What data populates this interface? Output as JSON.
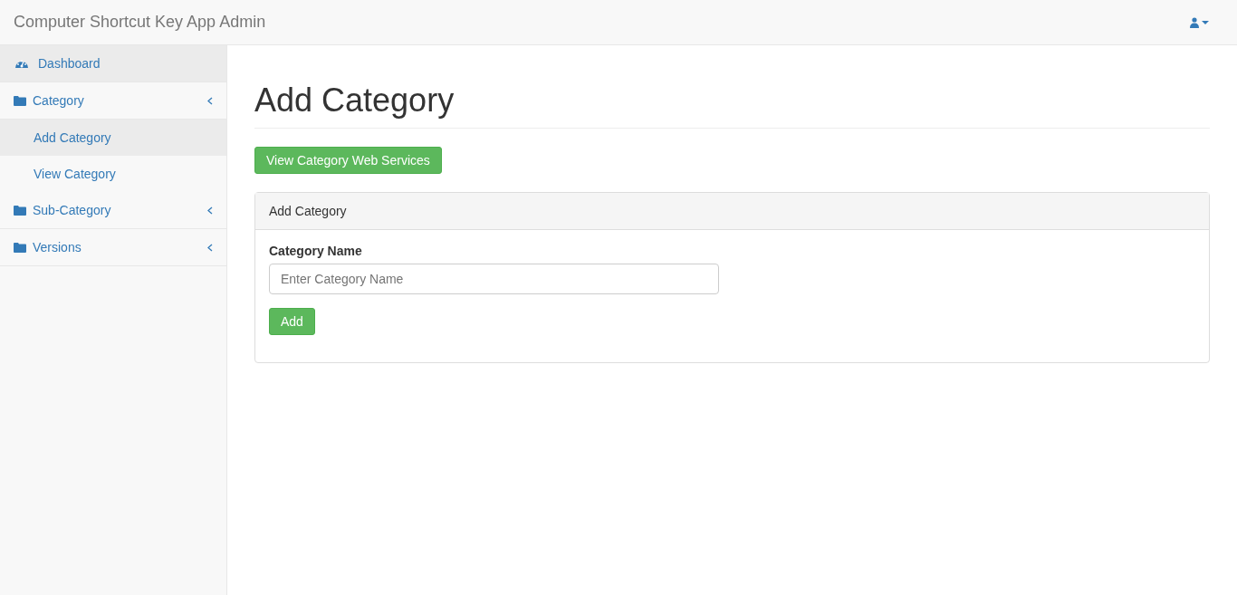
{
  "navbar": {
    "brand": "Computer Shortcut Key App Admin"
  },
  "sidebar": {
    "items": [
      {
        "kind": "dashboard",
        "label": "Dashboard",
        "selected": true
      },
      {
        "kind": "group",
        "label": "Category",
        "children": [
          {
            "label": "Add Category",
            "selected": true
          },
          {
            "label": "View Category",
            "selected": false
          }
        ]
      },
      {
        "kind": "group",
        "label": "Sub-Category"
      },
      {
        "kind": "group",
        "label": "Versions"
      }
    ]
  },
  "page": {
    "title": "Add Category",
    "action_button": "View Category Web Services",
    "panel": {
      "heading": "Add Category",
      "field_label": "Category Name",
      "placeholder": "Enter Category Name",
      "submit": "Add"
    }
  }
}
